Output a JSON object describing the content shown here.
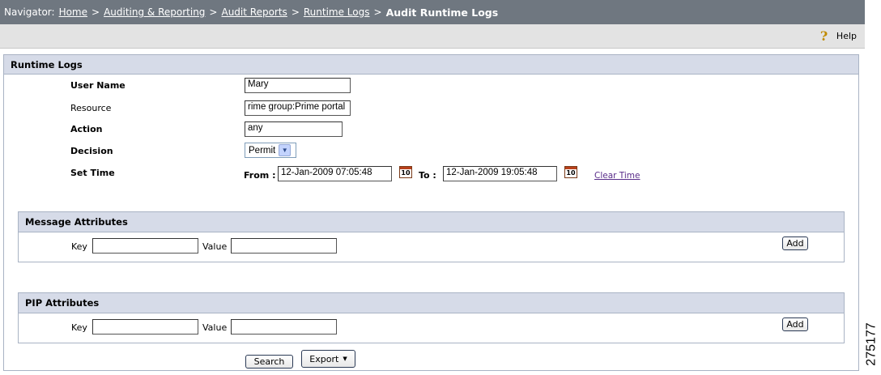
{
  "navigator": {
    "label": "Navigator:",
    "crumbs": [
      "Home",
      "Auditing & Reporting",
      "Audit Reports",
      "Runtime Logs"
    ],
    "separator": ">",
    "current": "Audit Runtime Logs"
  },
  "toolbar": {
    "help_label": "Help",
    "help_icon": "question-mark-icon"
  },
  "runtime_logs": {
    "title": "Runtime Logs",
    "user_name": {
      "label": "User Name",
      "value": "Mary"
    },
    "resource": {
      "label": "Resource",
      "value": "rime group:Prime portal"
    },
    "action": {
      "label": "Action",
      "value": "any"
    },
    "decision": {
      "label": "Decision",
      "value": "Permit"
    },
    "set_time": {
      "label": "Set Time",
      "from_label": "From :",
      "from_value": "12-Jan-2009 07:05:48",
      "to_label": "To :",
      "to_value": "12-Jan-2009 19:05:48",
      "clear_label": "Clear Time",
      "calendar_day": "10"
    }
  },
  "message_attributes": {
    "title": "Message Attributes",
    "key_label": "Key",
    "key_value": "",
    "value_label": "Value",
    "value_value": "",
    "add_label": "Add"
  },
  "pip_attributes": {
    "title": "PIP Attributes",
    "key_label": "Key",
    "key_value": "",
    "value_label": "Value",
    "value_value": "",
    "add_label": "Add"
  },
  "actions": {
    "search_label": "Search",
    "export_label": "Export"
  },
  "figure_number": "275177"
}
